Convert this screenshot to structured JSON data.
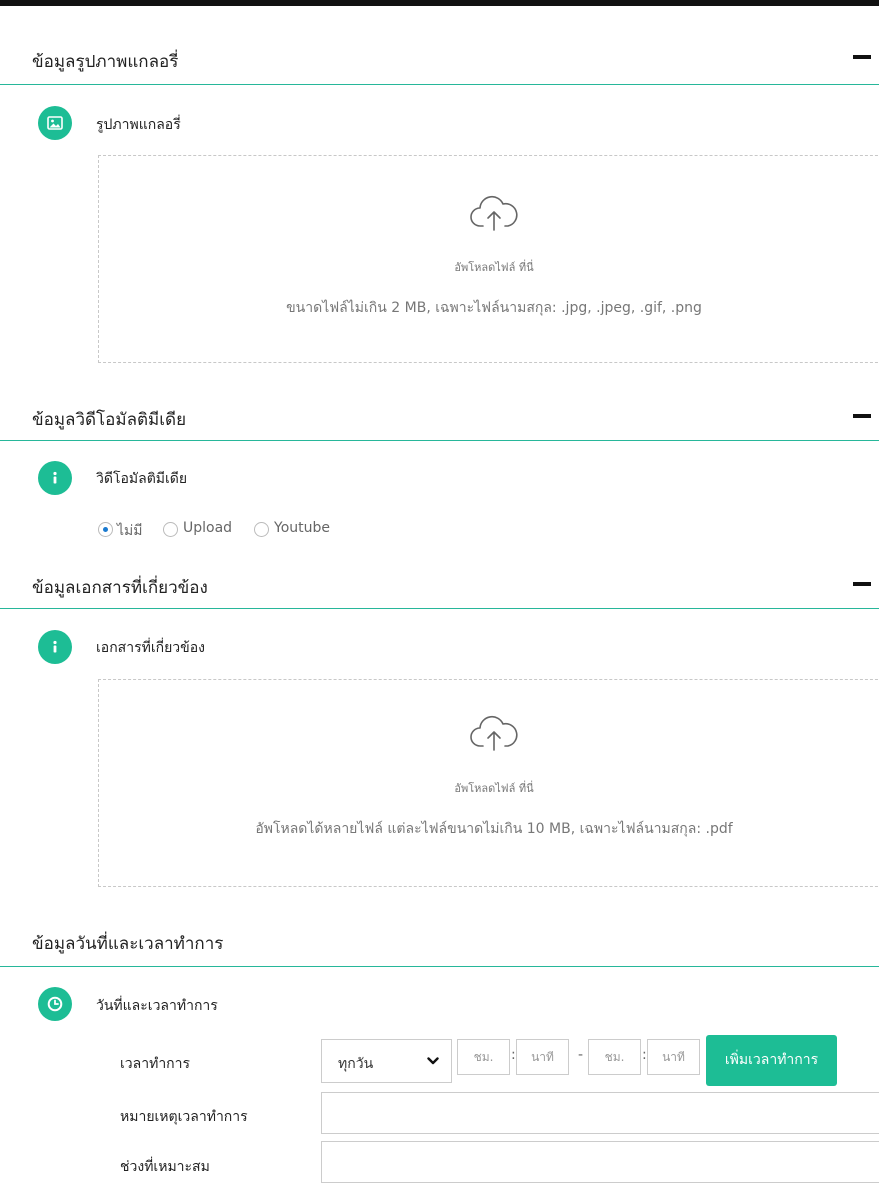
{
  "gallery": {
    "section_title": "ข้อมูลรูปภาพแกลอรี่",
    "field_label": "รูปภาพแกลอรี่",
    "upload_text": "อัพโหลดไฟล์ ที่นี่",
    "hint": "ขนาดไฟล์ไม่เกิน 2 MB, เฉพาะไฟล์นามสกุล: .jpg, .jpeg, .gif, .png"
  },
  "video": {
    "section_title": "ข้อมูลวิดีโอมัลติมีเดีย",
    "field_label": "วิดีโอมัลติมีเดีย",
    "options": [
      {
        "label": "ไม่มี",
        "selected": true
      },
      {
        "label": "Upload",
        "selected": false
      },
      {
        "label": "Youtube",
        "selected": false
      }
    ]
  },
  "documents": {
    "section_title": "ข้อมูลเอกสารที่เกี่ยวข้อง",
    "field_label": "เอกสารที่เกี่ยวข้อง",
    "upload_text": "อัพโหลดไฟล์ ที่นี่",
    "hint": "อัพโหลดได้หลายไฟล์ แต่ละไฟล์ขนาดไม่เกิน 10 MB, เฉพาะไฟล์นามสกุล: .pdf"
  },
  "hours": {
    "section_title": "ข้อมูลวันที่และเวลาทำการ",
    "field_label": "วันที่และเวลาทำการ",
    "time_label": "เวลาทำการ",
    "day_select": "ทุกวัน",
    "hour_placeholder": "ชม.",
    "minute_placeholder": "นาที",
    "colon": ":",
    "dash": "-",
    "add_button": "เพิ่มเวลาทำการ",
    "note_label": "หมายเหตุเวลาทำการ",
    "suitable_label": "ช่วงที่เหมาะสม"
  },
  "colors": {
    "accent": "#1dbd95",
    "divider": "#27b79a"
  }
}
